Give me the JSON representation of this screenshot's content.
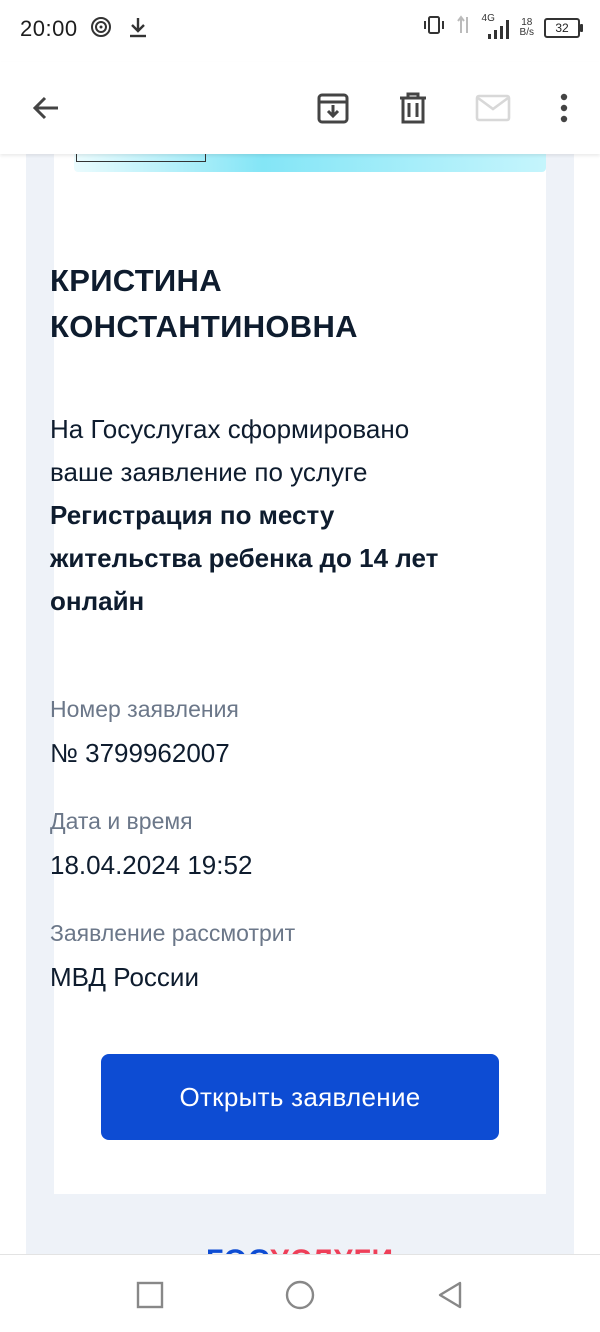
{
  "status_bar": {
    "time": "20:00",
    "network_type": "4G",
    "speed_value": "18",
    "speed_unit": "B/s",
    "battery": "32"
  },
  "toolbar": {
    "back_icon": "arrow-left-icon",
    "archive_icon": "archive-icon",
    "delete_icon": "trash-icon",
    "mark_unread_icon": "mail-icon",
    "more_icon": "more-vertical-icon"
  },
  "email": {
    "recipient_name": "КРИСТИНА КОНСТАНТИНОВНА",
    "intro_text": "На Госуслугах сформировано ваше заявление по услуге",
    "service_name": "Регистрация по месту жительства ребенка до 14 лет онлайн",
    "application_number_label": "Номер заявления",
    "application_number": "№ 3799962007",
    "datetime_label": "Дата и время",
    "datetime": "18.04.2024 19:52",
    "reviewer_label": "Заявление рассмотрит",
    "reviewer": "МВД России",
    "open_button_label": "Открыть заявление",
    "footer_logo_part1": "ГОС",
    "footer_logo_part2": "УСЛУГИ"
  },
  "colors": {
    "button_blue": "#0d4cd3",
    "text_dark": "#0e1c2e",
    "label_grey": "#6b7789",
    "logo_red": "#ee3f58"
  },
  "nav_bar": {
    "recents_icon": "square-icon",
    "home_icon": "circle-icon",
    "back_icon": "triangle-back-icon"
  }
}
